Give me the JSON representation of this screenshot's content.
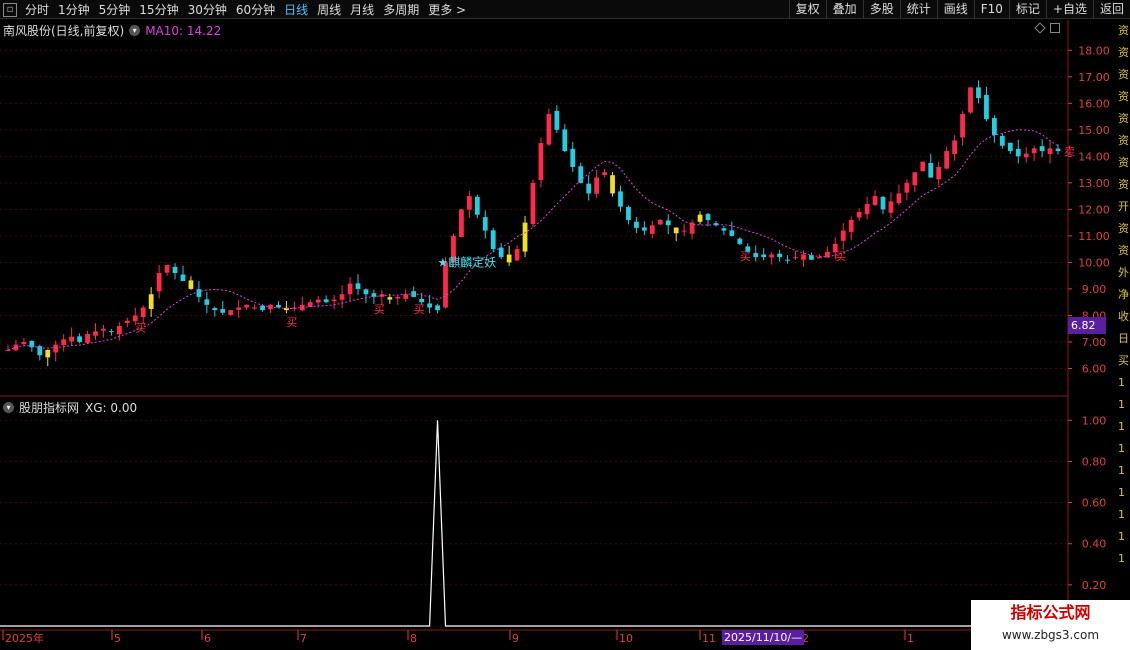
{
  "toolbar": {
    "periods": [
      {
        "label": "分时",
        "active": false
      },
      {
        "label": "1分钟",
        "active": false
      },
      {
        "label": "5分钟",
        "active": false
      },
      {
        "label": "15分钟",
        "active": false
      },
      {
        "label": "30分钟",
        "active": false
      },
      {
        "label": "60分钟",
        "active": false
      },
      {
        "label": "日线",
        "active": true
      },
      {
        "label": "周线",
        "active": false
      },
      {
        "label": "月线",
        "active": false
      },
      {
        "label": "多周期",
        "active": false
      },
      {
        "label": "更多 >",
        "active": false
      }
    ],
    "buttons": [
      "复权",
      "叠加",
      "多股",
      "统计",
      "画线",
      "F10",
      "标记",
      "+自选",
      "返回"
    ]
  },
  "main_panel": {
    "stock_title": "南风股份(日线,前复权)",
    "ma_label": "MA10: 14.22",
    "current_price_tag": "6.82"
  },
  "sub_panel": {
    "indicator_name": "股朋指标网",
    "xg_label": "XG: 0.00"
  },
  "date_cursor_tag": "2025/11/10/—",
  "right_strip_chars": [
    "资",
    "资",
    "资",
    "资",
    "资",
    "资",
    "资",
    "资",
    "开",
    "资",
    "资",
    "外",
    "净",
    "收",
    "日",
    "买",
    "1",
    "1",
    "1",
    "1",
    "1",
    "1",
    "1",
    "1",
    "1"
  ],
  "annotations": {
    "star_label": "★麒麟定妖",
    "buy_marks": [
      "买",
      "买",
      "买",
      "买",
      "买",
      "买",
      "买",
      "买"
    ],
    "sell_mark": "卖"
  },
  "watermark": {
    "title": "指标公式网",
    "url": "www.zbgs3.com"
  },
  "colors": {
    "up": "#ff2a4a",
    "down": "#20d0e0",
    "yellow": "#f0e020",
    "ma": "#e040e0",
    "axis": "#e04040",
    "signal": "#ffffff"
  },
  "chart_data": [
    {
      "type": "candlestick",
      "title": "南风股份(日线,前复权)",
      "ylim": [
        5.0,
        18.5
      ],
      "y_ticks": [
        6.0,
        7.0,
        8.0,
        9.0,
        10.0,
        11.0,
        12.0,
        13.0,
        14.0,
        15.0,
        16.0,
        17.0,
        18.0
      ],
      "x_tick_labels": [
        "2025年",
        "5",
        "6",
        "7",
        "8",
        "9",
        "10",
        "11",
        "2",
        "1"
      ],
      "close_path": [
        6.7,
        6.9,
        7.0,
        6.8,
        6.5,
        6.7,
        6.9,
        7.1,
        7.2,
        7.0,
        7.3,
        7.4,
        7.5,
        7.4,
        7.6,
        7.8,
        8.0,
        8.3,
        8.8,
        9.6,
        9.9,
        9.6,
        9.3,
        9.0,
        8.7,
        8.4,
        8.2,
        8.1,
        8.2,
        8.3,
        8.4,
        8.3,
        8.2,
        8.4,
        8.3,
        8.2,
        8.3,
        8.4,
        8.5,
        8.6,
        8.5,
        8.6,
        8.8,
        9.2,
        9.0,
        8.8,
        8.7,
        8.8,
        8.6,
        8.7,
        8.8,
        8.7,
        8.5,
        8.3,
        8.2,
        10.0,
        11.0,
        12.0,
        12.5,
        11.8,
        11.2,
        10.5,
        10.2,
        10.0,
        10.5,
        11.5,
        13.0,
        14.5,
        15.6,
        15.0,
        14.2,
        13.6,
        13.0,
        12.6,
        13.2,
        13.4,
        12.6,
        12.1,
        11.6,
        11.3,
        11.2,
        11.4,
        11.6,
        11.4,
        11.1,
        11.2,
        11.5,
        11.8,
        11.6,
        11.4,
        11.2,
        11.0,
        10.7,
        10.4,
        10.2,
        10.2,
        10.3,
        10.2,
        10.1,
        10.2,
        10.3,
        10.1,
        10.2,
        10.4,
        10.7,
        11.2,
        11.6,
        11.9,
        12.2,
        12.5,
        12.0,
        12.3,
        12.6,
        13.0,
        13.4,
        13.8,
        13.2,
        13.6,
        14.2,
        14.6,
        15.6,
        16.6,
        16.2,
        15.4,
        14.8,
        14.4,
        14.2,
        14.0,
        14.1,
        14.3,
        14.2,
        14.3,
        14.2
      ]
    },
    {
      "type": "line",
      "title": "股朋指标网",
      "series": [
        {
          "name": "XG",
          "values": [
            0,
            0,
            0,
            0,
            0,
            0,
            0,
            0,
            0,
            0,
            0,
            0,
            0,
            0,
            0,
            0,
            0,
            0,
            0,
            0,
            0,
            0,
            0,
            0,
            0,
            0,
            0,
            0,
            0,
            0,
            0,
            0,
            0,
            0,
            0,
            0,
            0,
            0,
            0,
            0,
            0,
            0,
            0,
            0,
            0,
            0,
            0,
            0,
            0,
            0,
            0,
            0,
            0,
            0,
            1,
            0,
            0,
            0,
            0,
            0,
            0,
            0,
            0,
            0,
            0,
            0,
            0,
            0,
            0,
            0,
            0,
            0,
            0,
            0,
            0,
            0,
            0,
            0,
            0,
            0,
            0,
            0,
            0,
            0,
            0,
            0,
            0,
            0,
            0,
            0,
            0,
            0,
            0,
            0,
            0,
            0,
            0,
            0,
            0,
            0,
            0,
            0,
            0,
            0,
            0,
            0,
            0,
            0,
            0,
            0,
            0,
            0,
            0,
            0,
            0,
            0,
            0,
            0,
            0,
            0,
            0,
            0,
            0,
            0,
            0,
            0,
            0,
            0,
            0,
            0,
            0,
            0,
            0,
            0,
            0
          ]
        }
      ],
      "ylim": [
        0,
        1.05
      ],
      "y_ticks": [
        0.2,
        0.4,
        0.6,
        0.8,
        1.0
      ]
    }
  ]
}
